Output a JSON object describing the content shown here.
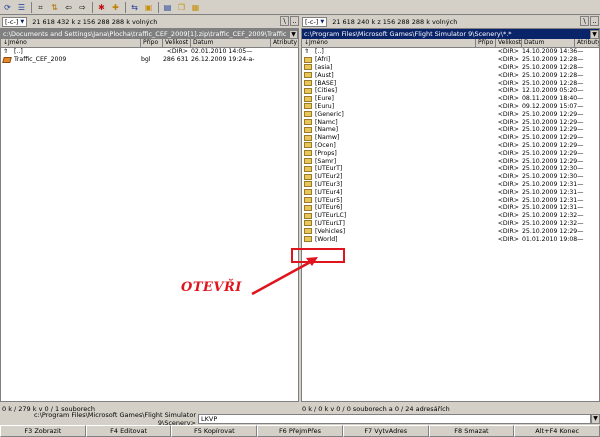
{
  "toolbar": {
    "buttons": [
      {
        "name": "refresh-icon",
        "glyph": "⟳",
        "color": "#1a3a9a"
      },
      {
        "name": "brief-view-icon",
        "glyph": "☰",
        "color": "#1a3a9a"
      },
      {
        "name": "sep"
      },
      {
        "name": "tree-icon",
        "glyph": "⌗",
        "color": "#333"
      },
      {
        "name": "sort-icon",
        "glyph": "⇅",
        "color": "#b07000"
      },
      {
        "name": "back-icon",
        "glyph": "⇦",
        "color": "#000"
      },
      {
        "name": "forward-icon",
        "glyph": "⇨",
        "color": "#000"
      },
      {
        "name": "sep"
      },
      {
        "name": "pack-icon",
        "glyph": "✱",
        "color": "#c01010"
      },
      {
        "name": "unpack-icon",
        "glyph": "✚",
        "color": "#c08000"
      },
      {
        "name": "sep"
      },
      {
        "name": "ftp-icon",
        "glyph": "⇆",
        "color": "#1a3a9a"
      },
      {
        "name": "find-icon",
        "glyph": "▣",
        "color": "#c89010"
      },
      {
        "name": "sep"
      },
      {
        "name": "notepad-icon",
        "glyph": "▤",
        "color": "#1a3a9a"
      },
      {
        "name": "copy-icon",
        "glyph": "❐",
        "color": "#c89010"
      },
      {
        "name": "view-icon",
        "glyph": "▦",
        "color": "#c89010"
      }
    ]
  },
  "left": {
    "drive": "[-c-]",
    "drive_info": "21 618 432 k z 156 288 288 k volných",
    "backslash": "\\",
    "up": "..",
    "path": "c:\\Documents and Settings\\Jana\\Plocha\\traffic_CEF_2009[1].zip\\traffic_CEF_2009\\Traffic",
    "history_btn": "▼",
    "columns": {
      "name": "↓Jméno",
      "ext": "Přípo",
      "size": "Velikost",
      "date": "Datum",
      "attr": "Atributy"
    },
    "rows": [
      {
        "icon": "up",
        "name": "[..]",
        "ext": "",
        "size": "<DIR>",
        "date": "02.01.2010 14:05—"
      },
      {
        "icon": "file",
        "name": "Traffic_CEF_2009",
        "ext": "bgl",
        "size": "286 631",
        "date": "26.12.2009 19:24-a-"
      }
    ],
    "status": "0 k / 279 k v 0 / 1 souborech"
  },
  "right": {
    "drive": "[-c-]",
    "drive_info": "21 618 240 k z 156 288 288 k volných",
    "backslash": "\\",
    "up": "..",
    "path": "c:\\Program Files\\Microsoft Games\\Flight Simulator 9\\Scenery\\*.*",
    "history_btn": "▼",
    "columns": {
      "name": "↓Jméno",
      "ext": "Přípo",
      "size": "Velikost",
      "date": "Datum",
      "attr": "Atributy"
    },
    "rows": [
      {
        "icon": "up",
        "name": "[..]",
        "size": "<DIR>",
        "date": "14.10.2009 14:36—"
      },
      {
        "icon": "folder",
        "name": "[Afri]",
        "size": "<DIR>",
        "date": "25.10.2009 12:28—"
      },
      {
        "icon": "folder",
        "name": "[asia]",
        "size": "<DIR>",
        "date": "25.10.2009 12:28—"
      },
      {
        "icon": "folder",
        "name": "[Aust]",
        "size": "<DIR>",
        "date": "25.10.2009 12:28—"
      },
      {
        "icon": "folder",
        "name": "[BASE]",
        "size": "<DIR>",
        "date": "25.10.2009 12:28—"
      },
      {
        "icon": "folder",
        "name": "[Cities]",
        "size": "<DIR>",
        "date": "12.10.2009 05:20—"
      },
      {
        "icon": "folder",
        "name": "[Eure]",
        "size": "<DIR>",
        "date": "08.11.2009 18:40—"
      },
      {
        "icon": "folder",
        "name": "[Euru]",
        "size": "<DIR>",
        "date": "09.12.2009 15:07—"
      },
      {
        "icon": "folder",
        "name": "[Generic]",
        "size": "<DIR>",
        "date": "25.10.2009 12:29—"
      },
      {
        "icon": "folder",
        "name": "[Namc]",
        "size": "<DIR>",
        "date": "25.10.2009 12:29—"
      },
      {
        "icon": "folder",
        "name": "[Name]",
        "size": "<DIR>",
        "date": "25.10.2009 12:29—"
      },
      {
        "icon": "folder",
        "name": "[Namw]",
        "size": "<DIR>",
        "date": "25.10.2009 12:29—"
      },
      {
        "icon": "folder",
        "name": "[Ocen]",
        "size": "<DIR>",
        "date": "25.10.2009 12:29—"
      },
      {
        "icon": "folder",
        "name": "[Props]",
        "size": "<DIR>",
        "date": "25.10.2009 12:29—"
      },
      {
        "icon": "folder",
        "name": "[Samr]",
        "size": "<DIR>",
        "date": "25.10.2009 12:29—"
      },
      {
        "icon": "folder",
        "name": "[UTEurT]",
        "size": "<DIR>",
        "date": "25.10.2009 12:30—"
      },
      {
        "icon": "folder",
        "name": "[UTEur2]",
        "size": "<DIR>",
        "date": "25.10.2009 12:30—"
      },
      {
        "icon": "folder",
        "name": "[UTEur3]",
        "size": "<DIR>",
        "date": "25.10.2009 12:31—"
      },
      {
        "icon": "folder",
        "name": "[UTEur4]",
        "size": "<DIR>",
        "date": "25.10.2009 12:31—"
      },
      {
        "icon": "folder",
        "name": "[UTEur5]",
        "size": "<DIR>",
        "date": "25.10.2009 12:31—"
      },
      {
        "icon": "folder",
        "name": "[UTEur6]",
        "size": "<DIR>",
        "date": "25.10.2009 12:31—"
      },
      {
        "icon": "folder",
        "name": "[UTEurLC]",
        "size": "<DIR>",
        "date": "25.10.2009 12:32—"
      },
      {
        "icon": "folder",
        "name": "[UTEurLT]",
        "size": "<DIR>",
        "date": "25.10.2009 12:32—"
      },
      {
        "icon": "folder",
        "name": "[Vehicles]",
        "size": "<DIR>",
        "date": "25.10.2009 12:29—"
      },
      {
        "icon": "folder",
        "name": "[World]",
        "size": "<DIR>",
        "date": "01.01.2010 19:08—"
      }
    ],
    "status": "0 k / 0 k v 0 / 0 souborech a 0 / 24 adresářích"
  },
  "cmdline": {
    "prompt": "c:\\Program Files\\Microsoft Games\\Flight Simulator 9\\Scenery>",
    "value": "LKVP"
  },
  "fkeys": [
    "F3 Zobrazit",
    "F4 Editovat",
    "F5 Kopírovat",
    "F6 PřejmPřes",
    "F7 VytvAdres",
    "F8 Smazat",
    "Alt+F4 Konec"
  ],
  "annotation": {
    "text": "OTEVŘI",
    "color": "#e0141c"
  },
  "colors": {
    "active_path": "#0a246a",
    "chrome": "#d4d0c8"
  }
}
